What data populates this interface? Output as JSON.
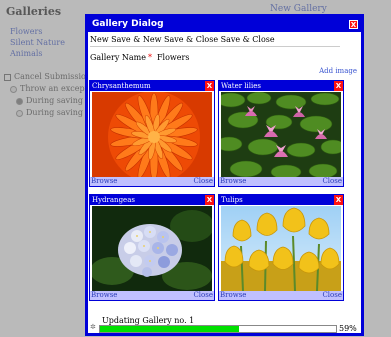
{
  "background": {
    "title": "Galleries",
    "new_gallery": "New Gallery",
    "gallery_links": [
      "Flowers",
      "Silent Nature",
      "Animals"
    ],
    "options": {
      "cancel_submission": "Cancel Submission",
      "throw_exception": "Throw an exception",
      "during_saving_data": "During saving data",
      "during_saving_image": "During saving image"
    }
  },
  "dialog": {
    "title": "Gallery Dialog",
    "close_glyph": "X",
    "toolbar": {
      "new": "New",
      "save": "Save",
      "new_save_close": "New Save & Close",
      "save_close": "Save & Close",
      "amp": "&"
    },
    "name_label": "Gallery Name",
    "required_mark": "*",
    "name_value": "Flowers",
    "add_image": "Add image",
    "panels": [
      {
        "name": "Chrysanthemum",
        "browse": "Browse",
        "close": "Close"
      },
      {
        "name": "Water lilies",
        "browse": "Browse",
        "close": "Close"
      },
      {
        "name": "Hydrangeas",
        "browse": "Browse",
        "close": "Close"
      },
      {
        "name": "Tulips",
        "browse": "Browse",
        "close": "Close"
      }
    ],
    "status_text": "Updating Gallery no. 1",
    "progress_percent_text": "59%",
    "progress_fraction": 0.59
  },
  "colors": {
    "dialog_blue": "#0000d8",
    "close_red": "#ff1111",
    "progress_green": "#00e000",
    "link_blue": "#3a55d0"
  },
  "icons": {
    "close": "close-icon",
    "spinner": "loading-spinner-icon"
  }
}
